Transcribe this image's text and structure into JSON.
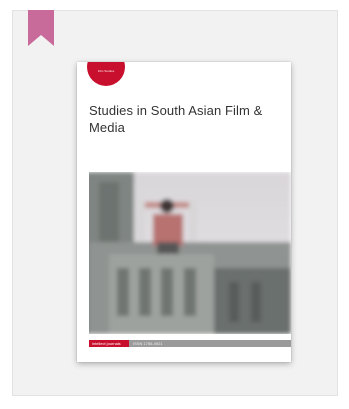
{
  "card": {
    "bookmark_icon": "bookmark-icon",
    "colors": {
      "bookmark": "#c86a9a",
      "card_background": "#f2f2f2",
      "publisher_red": "#c8102e",
      "footer_gray": "#9a9a9a"
    }
  },
  "cover": {
    "badge_text": "Film Studies",
    "title": "Studies in South Asian Film & Media",
    "footer_brand": "intellect journals",
    "footer_issn": "ISSN 1756-4921"
  }
}
